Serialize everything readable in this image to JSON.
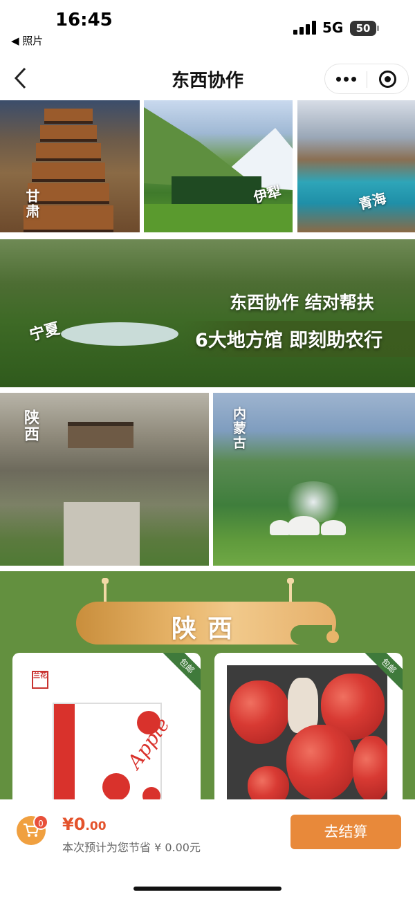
{
  "status": {
    "time": "16:45",
    "back_app": "◀ 照片",
    "network": "5G",
    "battery": "50"
  },
  "nav": {
    "title": "东西协作"
  },
  "regions": {
    "gansu": "甘肃",
    "yili": "伊犁",
    "qinghai": "青海",
    "ningxia": "宁夏",
    "shaanxi": "陕西",
    "neimenggu": "内蒙古"
  },
  "banner": {
    "line1": "东西协作 结对帮扶",
    "line2": "6大地方馆 即刻助农行"
  },
  "section": {
    "title": "陕西"
  },
  "products": [
    {
      "tag": "包邮",
      "brand_mark": "兰花",
      "box_text": "Apple"
    },
    {
      "tag": "包邮"
    }
  ],
  "cart": {
    "count": "0",
    "currency": "¥",
    "price_int": "0",
    "price_dec": ".00",
    "saving_text": "本次预计为您节省 ¥ 0.00元",
    "checkout_label": "去结算"
  },
  "colors": {
    "accent": "#e8893a",
    "price": "#e4532c",
    "section_bg": "#63903f"
  }
}
